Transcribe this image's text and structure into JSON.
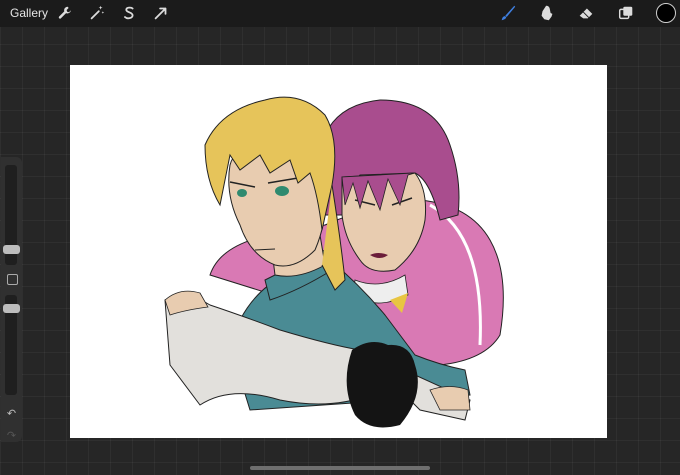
{
  "topbar": {
    "gallery_label": "Gallery",
    "left_tools": [
      {
        "icon": "wrench-icon"
      },
      {
        "icon": "magic-wand-icon"
      },
      {
        "icon": "selection-s-icon"
      },
      {
        "icon": "transform-arrow-icon"
      }
    ],
    "right_tools": [
      {
        "icon": "brush-icon"
      },
      {
        "icon": "smudge-icon"
      },
      {
        "icon": "eraser-icon"
      },
      {
        "icon": "layers-icon"
      }
    ],
    "current_color": "#000000",
    "active_tool_color": "#3f7fe0"
  },
  "sidebar": {
    "brush_size_slider": {
      "icon": "slider-handle"
    },
    "modify_button": {
      "icon": "square-icon"
    },
    "opacity_slider": {
      "icon": "slider-handle"
    },
    "undo": {
      "glyph": "↶",
      "icon": "undo-icon"
    },
    "redo": {
      "glyph": "↷",
      "icon": "redo-icon"
    }
  },
  "canvas": {
    "background": "#ffffff",
    "palette": {
      "blonde_hair": "#e6c45a",
      "pink_hair": "#a94d8e",
      "skin": "#e8ccb0",
      "teal_top": "#4a8b94",
      "pink_jacket": "#d979b4",
      "white_sleeve": "#e2e0dc",
      "black_fur": "#141414"
    }
  }
}
